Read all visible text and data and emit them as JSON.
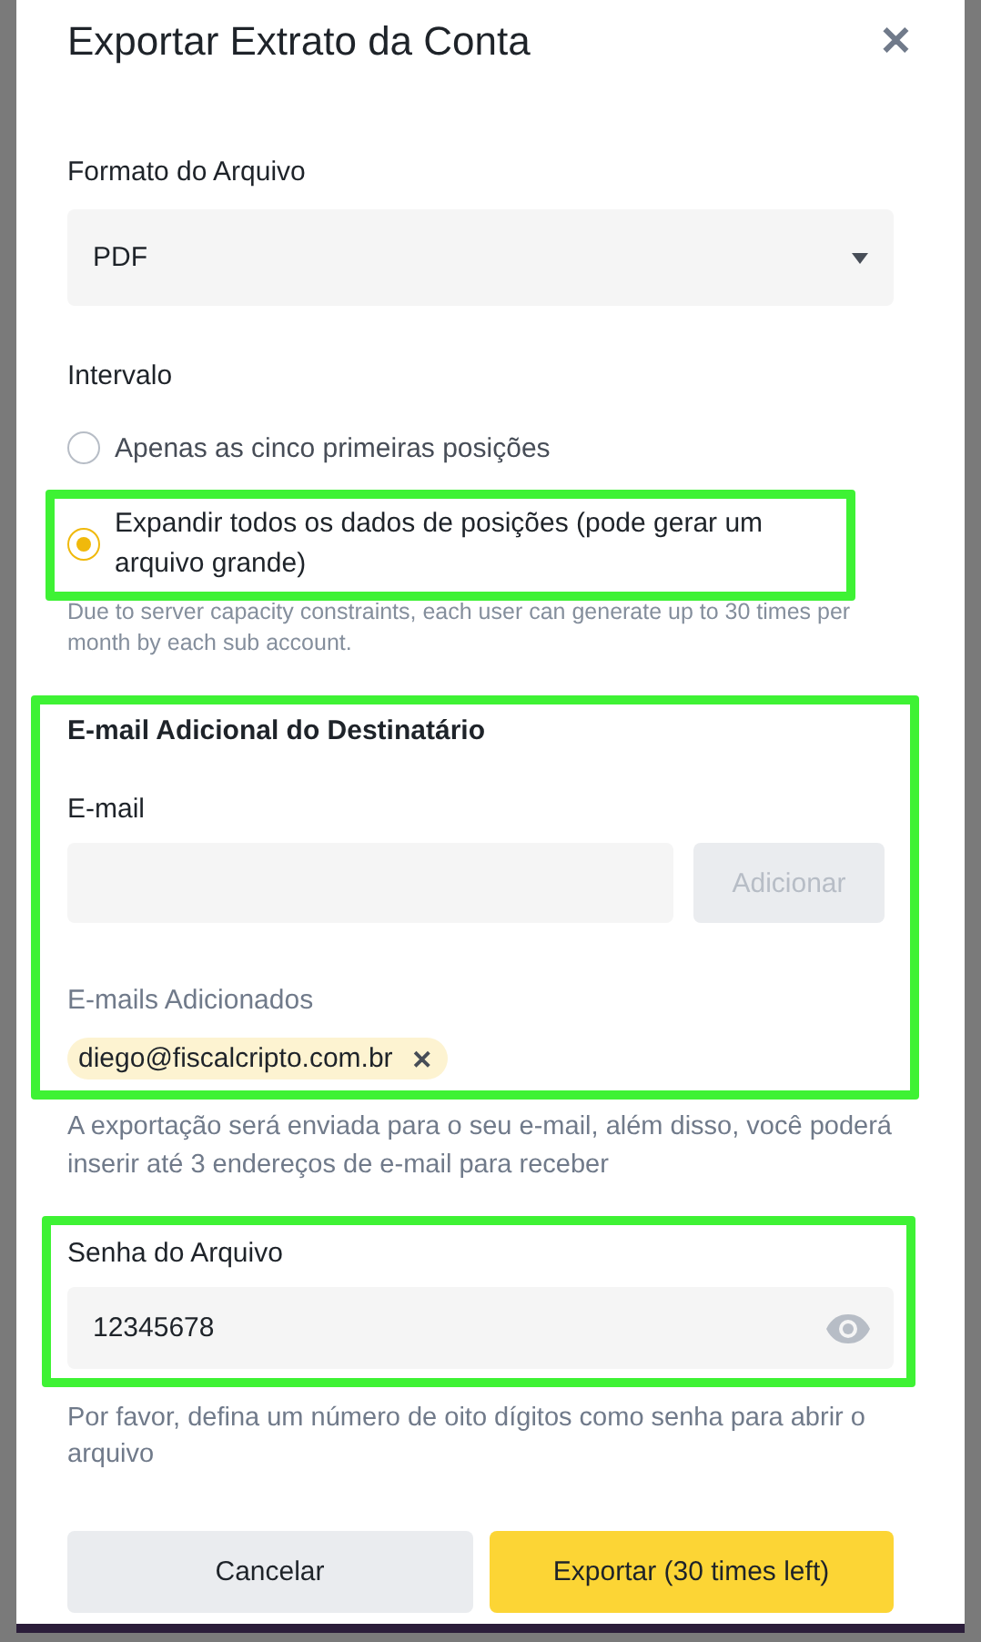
{
  "dialog": {
    "title": "Exportar Extrato da Conta",
    "close": "✕"
  },
  "file_format": {
    "label": "Formato do Arquivo",
    "value": "PDF"
  },
  "interval": {
    "label": "Intervalo",
    "options": [
      {
        "label": "Apenas as cinco primeiras posições",
        "selected": false,
        "highlighted": false
      },
      {
        "label": "Expandir todos os dados de posições (pode gerar um arquivo grande)",
        "selected": true,
        "highlighted": true
      }
    ],
    "note": "Due to server capacity constraints, each user can generate up to 30 times per month by each sub account."
  },
  "recipient_email": {
    "highlighted": true,
    "title": "E-mail Adicional do Destinatário",
    "email_label": "E-mail",
    "add_button": {
      "label": "Adicionar",
      "disabled": true
    },
    "added_label": "E-mails Adicionados",
    "added": [
      {
        "email": "diego@fiscalcripto.com.br",
        "remove": "✕"
      }
    ]
  },
  "email_info": "A exportação será enviada para o seu e-mail, além disso, você poderá inserir até 3 endereços de e-mail para receber",
  "file_password": {
    "highlighted": true,
    "label": "Senha do Arquivo",
    "value": "12345678",
    "hint": "Por favor, defina um número de oito dígitos como senha para abrir o arquivo"
  },
  "buttons": [
    {
      "label": "Cancelar",
      "kind": "secondary"
    },
    {
      "label": "Exportar (30 times left)",
      "kind": "primary"
    }
  ]
}
